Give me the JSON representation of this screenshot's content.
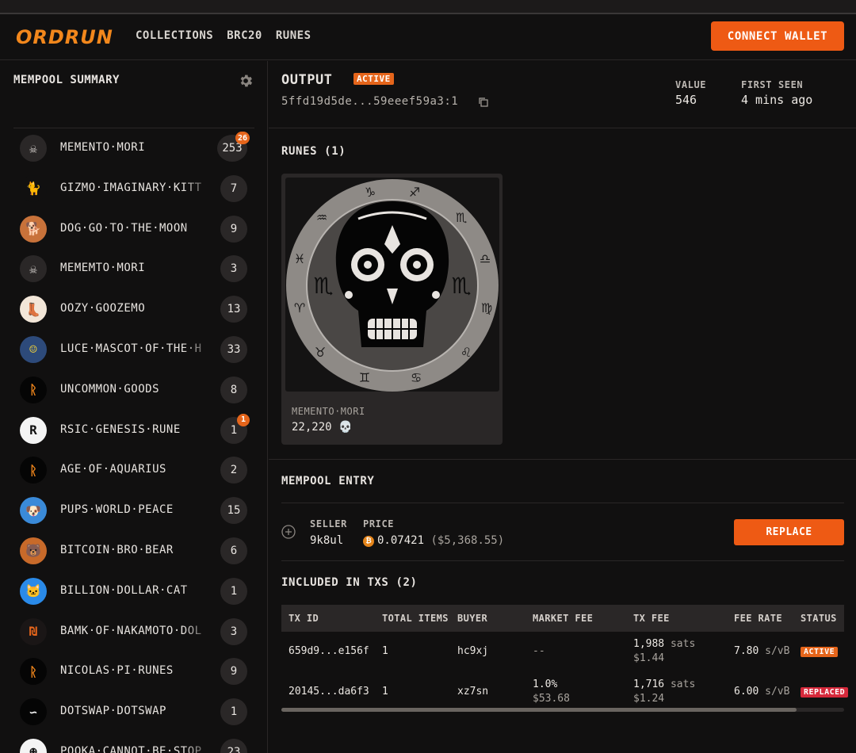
{
  "header": {
    "logo": "ORDRUN",
    "nav": [
      "COLLECTIONS",
      "BRC20",
      "RUNES"
    ],
    "connect_label": "CONNECT WALLET"
  },
  "sidebar": {
    "title": "MEMPOOL SUMMARY",
    "items": [
      {
        "name": "MEMENTO·MORI",
        "count": "253",
        "badge": "26",
        "icon": "skull-icon"
      },
      {
        "name": "GIZMO·IMAGINARY·KITT",
        "count": "7",
        "badge": null,
        "icon": "kitten-icon"
      },
      {
        "name": "DOG·GO·TO·THE·MOON",
        "count": "9",
        "badge": null,
        "icon": "dog-icon"
      },
      {
        "name": "MEMEMTO·MORI",
        "count": "3",
        "badge": null,
        "icon": "skull-icon"
      },
      {
        "name": "OOZY·GOOZEMO",
        "count": "13",
        "badge": null,
        "icon": "boot-icon"
      },
      {
        "name": "LUCE·MASCOT·OF·THE·H",
        "count": "33",
        "badge": null,
        "icon": "mascot-icon"
      },
      {
        "name": "UNCOMMON·GOODS",
        "count": "8",
        "badge": null,
        "icon": "rune-icon"
      },
      {
        "name": "RSIC·GENESIS·RUNE",
        "count": "1",
        "badge": "1",
        "icon": "rsic-icon"
      },
      {
        "name": "AGE·OF·AQUARIUS",
        "count": "2",
        "badge": null,
        "icon": "rune-icon"
      },
      {
        "name": "PUPS·WORLD·PEACE",
        "count": "15",
        "badge": null,
        "icon": "pups-icon"
      },
      {
        "name": "BITCOIN·BRO·BEAR",
        "count": "6",
        "badge": null,
        "icon": "bear-icon"
      },
      {
        "name": "BILLION·DOLLAR·CAT",
        "count": "1",
        "badge": null,
        "icon": "cat-icon"
      },
      {
        "name": "BAMK·OF·NAKAMOTO·DOL",
        "count": "3",
        "badge": null,
        "icon": "bamk-icon"
      },
      {
        "name": "NICOLAS·PI·RUNES",
        "count": "9",
        "badge": null,
        "icon": "rune-icon"
      },
      {
        "name": "DOTSWAP·DOTSWAP",
        "count": "1",
        "badge": null,
        "icon": "dotswap-icon"
      },
      {
        "name": "POOKA·CANNOT·BE·STOP",
        "count": "23",
        "badge": null,
        "icon": "pooka-icon"
      }
    ]
  },
  "output": {
    "title": "OUTPUT",
    "status": "ACTIVE",
    "id": "5ffd19d5de...59eeef59a3:1",
    "value_label": "VALUE",
    "value": "546",
    "first_seen_label": "FIRST SEEN",
    "first_seen": "4 mins ago"
  },
  "runes": {
    "title": "RUNES (1)",
    "card": {
      "name": "MEMENTO·MORI",
      "amount": "22,220 💀"
    }
  },
  "mempool_entry": {
    "title": "MEMPOOL ENTRY",
    "seller_label": "SELLER",
    "seller": "9k8ul",
    "price_label": "PRICE",
    "price_btc": "0.07421",
    "price_usd": "($5,368.55)",
    "btc_symbol": "₿",
    "replace_label": "REPLACE"
  },
  "txs": {
    "title": "INCLUDED IN TXS (2)",
    "columns": [
      "TX ID",
      "TOTAL ITEMS",
      "BUYER",
      "MARKET FEE",
      "TX FEE",
      "FEE RATE",
      "STATUS"
    ],
    "rows": [
      {
        "id": "659d9...e156f",
        "items": "1",
        "buyer": "hc9xj",
        "market_fee": "--",
        "market_fee_usd": "",
        "tx_fee": "1,988",
        "tx_fee_unit": "sats",
        "tx_fee_usd": "$1.44",
        "fee_rate": "7.80",
        "fee_rate_unit": "s/vB",
        "status": "ACTIVE"
      },
      {
        "id": "20145...da6f3",
        "items": "1",
        "buyer": "xz7sn",
        "market_fee": "1.0%",
        "market_fee_usd": "$53.68",
        "tx_fee": "1,716",
        "tx_fee_unit": "sats",
        "tx_fee_usd": "$1.24",
        "fee_rate": "6.00",
        "fee_rate_unit": "s/vB",
        "status": "REPLACED"
      }
    ]
  },
  "colors": {
    "accent": "#ee5a14",
    "replaced": "#d6293b",
    "background": "#111010",
    "surface": "#2a2727"
  }
}
